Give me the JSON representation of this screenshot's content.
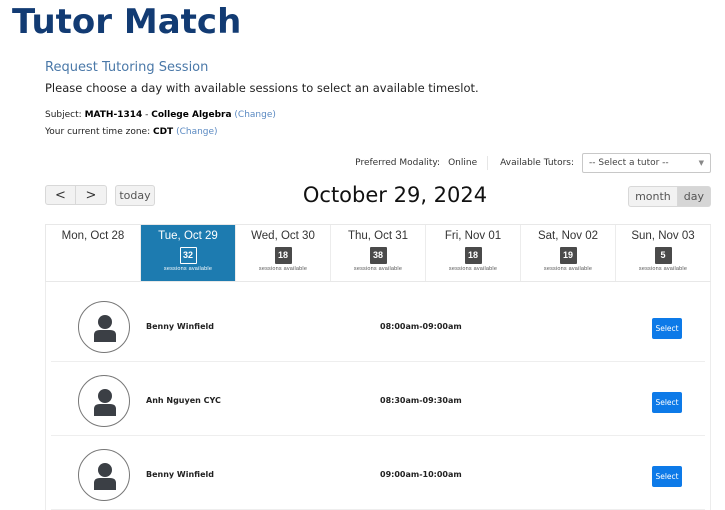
{
  "app": {
    "title": "Tutor Match"
  },
  "page": {
    "section_title": "Request Tutoring Session",
    "instructions": "Please choose a day with available sessions to select an available timeslot.",
    "subject_label": "Subject:",
    "subject_code": "MATH-1314",
    "subject_separator": "-",
    "subject_name": "College Algebra",
    "subject_change": "(Change)",
    "timezone_label": "Your current time zone:",
    "timezone_value": "CDT",
    "timezone_change": "(Change)"
  },
  "filters": {
    "modality_label": "Preferred Modality:",
    "modality_value": "Online",
    "tutors_label": "Available Tutors:",
    "tutors_selected": "-- Select a tutor --",
    "caret_icon": "chevron-down-icon"
  },
  "calendar": {
    "prev_label": "<",
    "next_label": ">",
    "today_label": "today",
    "title": "October 29, 2024",
    "view_month": "month",
    "view_day": "day",
    "active_view": "day",
    "sessions_text": "sessions available",
    "days": [
      {
        "label": "Mon, Oct 28",
        "count": null,
        "selected": false
      },
      {
        "label": "Tue, Oct 29",
        "count": "32",
        "selected": true
      },
      {
        "label": "Wed, Oct 30",
        "count": "18",
        "selected": false
      },
      {
        "label": "Thu, Oct 31",
        "count": "38",
        "selected": false
      },
      {
        "label": "Fri, Nov 01",
        "count": "18",
        "selected": false
      },
      {
        "label": "Sat, Nov 02",
        "count": "19",
        "selected": false
      },
      {
        "label": "Sun, Nov 03",
        "count": "5",
        "selected": false
      }
    ]
  },
  "slots": [
    {
      "tutor": "Benny Winfield",
      "time": "08:00am-09:00am",
      "button": "Select"
    },
    {
      "tutor": "Anh Nguyen CYC",
      "time": "08:30am-09:30am",
      "button": "Select"
    },
    {
      "tutor": "Benny Winfield",
      "time": "09:00am-10:00am",
      "button": "Select"
    }
  ],
  "colors": {
    "title": "#123b73",
    "selected_day": "#1d7bb0",
    "select_button": "#0d7ae8",
    "link": "#5b8ac2"
  }
}
